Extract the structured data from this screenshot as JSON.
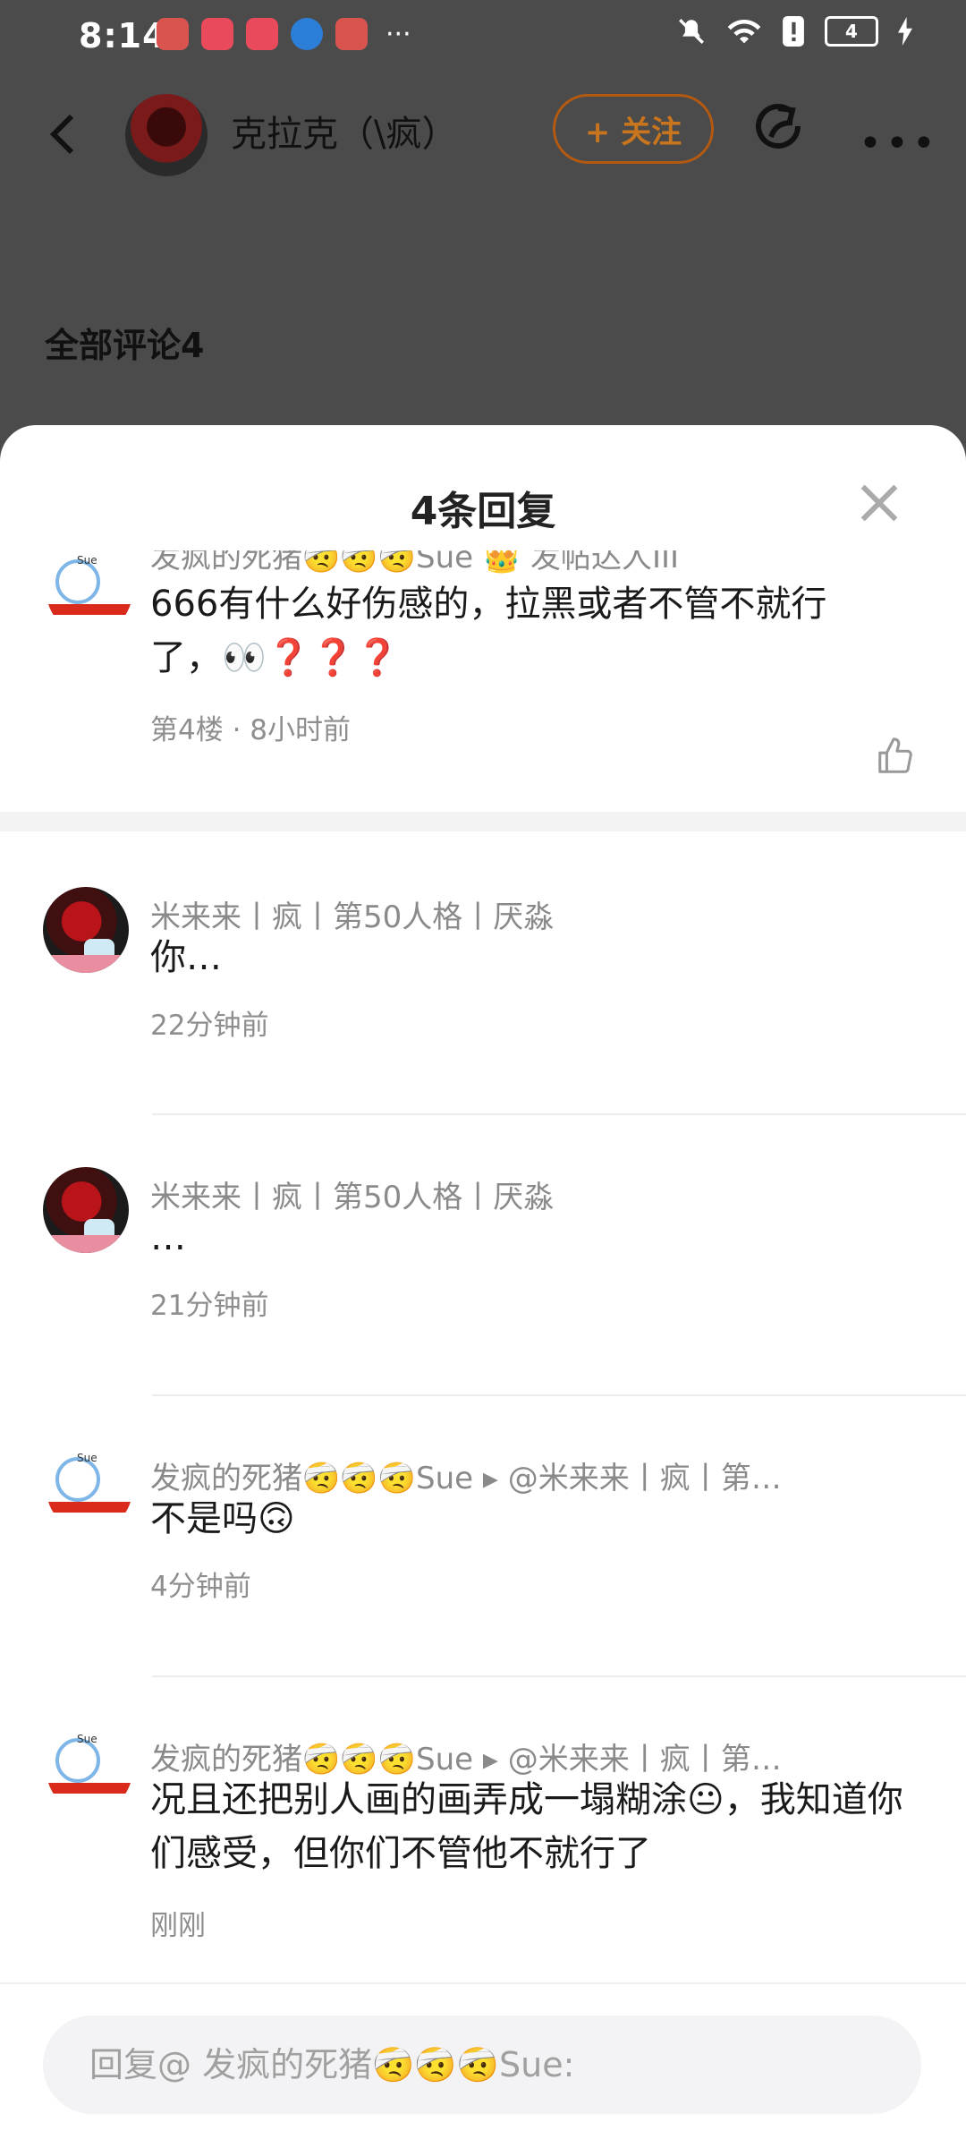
{
  "status_bar": {
    "time": "8:14",
    "battery": "4",
    "more": "···"
  },
  "header": {
    "author": "克拉克（\\疯）",
    "follow_label": "+ 关注"
  },
  "comments_heading": "全部评论4",
  "sheet": {
    "title": "4条回复"
  },
  "main_comment": {
    "name": "发疯的死猪🤕🤕🤕Sue 👑 发帖达人III",
    "text": "666有什么好伤感的，拉黑或者不管不就行了，👀❓❓❓",
    "meta": "第4楼 · 8小时前"
  },
  "replies": [
    {
      "name": "米来来丨疯丨第50人格丨厌淼",
      "text": "你…",
      "time": "22分钟前",
      "avatar": "mi"
    },
    {
      "name": "米来来丨疯丨第50人格丨厌淼",
      "text": "…",
      "time": "21分钟前",
      "avatar": "mi"
    },
    {
      "name": "发疯的死猪🤕🤕🤕Sue ▸ @米来来丨疯丨第…",
      "text": "不是吗🙃",
      "time": "4分钟前",
      "avatar": "sue"
    },
    {
      "name": "发疯的死猪🤕🤕🤕Sue ▸ @米来来丨疯丨第…",
      "text": "况且还把别人画的画弄成一塌糊涂😐，我知道你们感受，但你们不管他不就行了",
      "time": "刚刚",
      "avatar": "sue"
    }
  ],
  "input": {
    "placeholder": "回复@ 发疯的死猪🤕🤕🤕Sue:"
  }
}
